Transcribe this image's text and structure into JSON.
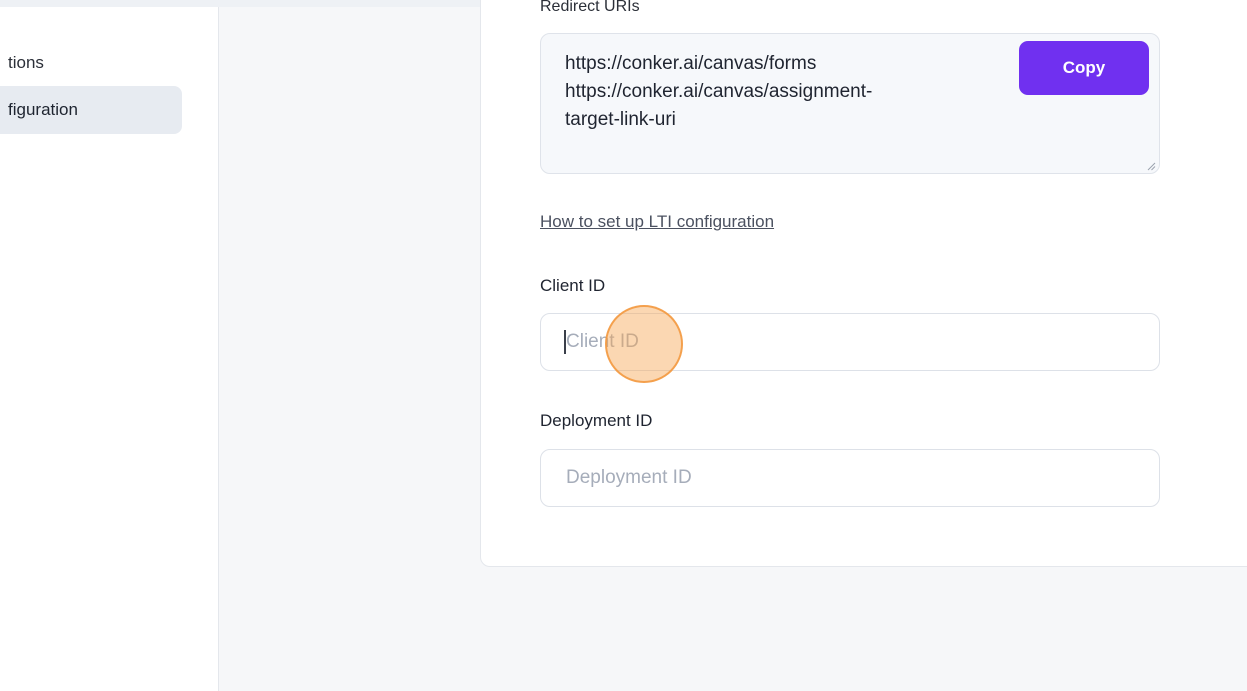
{
  "sidebar": {
    "items": [
      {
        "label": "tions",
        "active": false
      },
      {
        "label": "figuration",
        "active": true
      }
    ]
  },
  "lti": {
    "redirect_uris_label": "Redirect URIs",
    "redirect_uris_value": "https://conker.ai/canvas/forms\nhttps://conker.ai/canvas/assignment-\ntarget-link-uri",
    "copy_label": "Copy",
    "help_link": "How to set up LTI configuration",
    "client_id": {
      "label": "Client ID",
      "placeholder": "Client ID",
      "value": ""
    },
    "deployment_id": {
      "label": "Deployment ID",
      "placeholder": "Deployment ID",
      "value": ""
    }
  },
  "colors": {
    "accent": "#7030f0",
    "click_marker": "#f7a654",
    "active_nav_bg": "#e7ebf1"
  }
}
